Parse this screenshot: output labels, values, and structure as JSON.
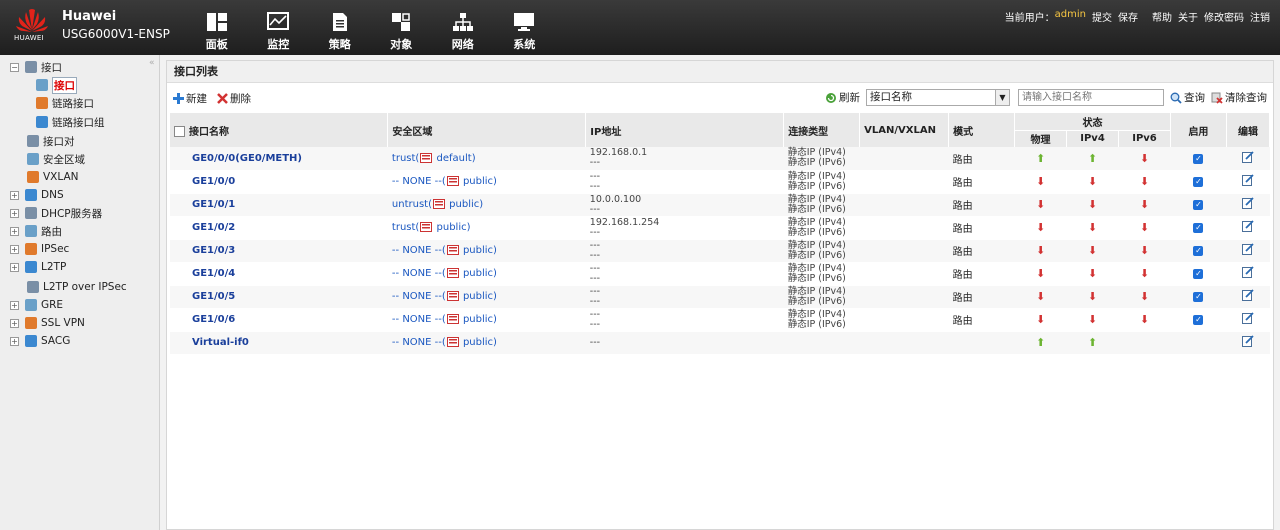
{
  "header": {
    "logo_text": "HUAWEI",
    "brand": "Huawei",
    "model": "USG6000V1-ENSP",
    "nav": [
      {
        "label": "面板",
        "icon": "dashboard-icon"
      },
      {
        "label": "监控",
        "icon": "monitor-icon"
      },
      {
        "label": "策略",
        "icon": "policy-icon"
      },
      {
        "label": "对象",
        "icon": "object-icon"
      },
      {
        "label": "网络",
        "icon": "network-icon"
      },
      {
        "label": "系统",
        "icon": "system-icon"
      }
    ],
    "current_user_label": "当前用户：",
    "current_user": "admin",
    "links": [
      "提交",
      "保存",
      "帮助",
      "关于",
      "修改密码",
      "注销"
    ]
  },
  "sidebar": {
    "items": [
      {
        "label": "接口",
        "toggle": "−",
        "icon": "interface-icon"
      },
      {
        "label": "接口",
        "selected": true,
        "icon": "interface-icon"
      },
      {
        "label": "链路接口",
        "icon": "link-interface-icon"
      },
      {
        "label": "链路接口组",
        "icon": "link-group-icon"
      },
      {
        "label": "接口对",
        "icon": "interface-pair-icon"
      },
      {
        "label": "安全区域",
        "icon": "security-zone-icon"
      },
      {
        "label": "VXLAN",
        "icon": "vxlan-icon"
      },
      {
        "label": "DNS",
        "toggle": "+",
        "icon": "dns-icon"
      },
      {
        "label": "DHCP服务器",
        "toggle": "+",
        "icon": "dhcp-icon"
      },
      {
        "label": "路由",
        "toggle": "+",
        "icon": "route-icon"
      },
      {
        "label": "IPSec",
        "toggle": "+",
        "icon": "ipsec-icon"
      },
      {
        "label": "L2TP",
        "toggle": "+",
        "icon": "l2tp-icon"
      },
      {
        "label": "L2TP over IPSec",
        "icon": "l2tp-ipsec-icon"
      },
      {
        "label": "GRE",
        "toggle": "+",
        "icon": "gre-icon"
      },
      {
        "label": "SSL VPN",
        "toggle": "+",
        "icon": "sslvpn-icon"
      },
      {
        "label": "SACG",
        "toggle": "+",
        "icon": "sacg-icon"
      }
    ]
  },
  "main": {
    "title": "接口列表",
    "toolbar": {
      "new_label": "新建",
      "delete_label": "删除",
      "refresh_label": "刷新",
      "select_value": "接口名称",
      "search_placeholder": "请输入接口名称",
      "query_label": "查询",
      "clear_label": "清除查询"
    },
    "columns": {
      "name": "接口名称",
      "zone": "安全区域",
      "ip": "IP地址",
      "conn": "连接类型",
      "vlan": "VLAN/VXLAN",
      "mode": "模式",
      "status": "状态",
      "physical": "物理",
      "ipv4": "IPv4",
      "ipv6": "IPv6",
      "enable": "启用",
      "edit": "编辑"
    },
    "rows": [
      {
        "name": "GE0/0/0(GE0/METH)",
        "zone_a": "trust(",
        "zone_b": " default)",
        "ip1": "192.168.0.1",
        "ip2": "---",
        "conn1": "静态IP (IPv4)",
        "conn2": "静态IP (IPv6)",
        "mode": "路由",
        "phy": "up",
        "v4": "up",
        "v6": "down",
        "enabled": true
      },
      {
        "name": "GE1/0/0",
        "zone_a": "-- NONE --(",
        "zone_b": " public)",
        "ip1": "---",
        "ip2": "---",
        "conn1": "静态IP (IPv4)",
        "conn2": "静态IP (IPv6)",
        "mode": "路由",
        "phy": "down",
        "v4": "down",
        "v6": "down",
        "enabled": true
      },
      {
        "name": "GE1/0/1",
        "zone_a": "untrust(",
        "zone_b": " public)",
        "ip1": "10.0.0.100",
        "ip2": "---",
        "conn1": "静态IP (IPv4)",
        "conn2": "静态IP (IPv6)",
        "mode": "路由",
        "phy": "down",
        "v4": "down",
        "v6": "down",
        "enabled": true
      },
      {
        "name": "GE1/0/2",
        "zone_a": "trust(",
        "zone_b": " public)",
        "ip1": "192.168.1.254",
        "ip2": "---",
        "conn1": "静态IP (IPv4)",
        "conn2": "静态IP (IPv6)",
        "mode": "路由",
        "phy": "down",
        "v4": "down",
        "v6": "down",
        "enabled": true
      },
      {
        "name": "GE1/0/3",
        "zone_a": "-- NONE --(",
        "zone_b": " public)",
        "ip1": "---",
        "ip2": "---",
        "conn1": "静态IP (IPv4)",
        "conn2": "静态IP (IPv6)",
        "mode": "路由",
        "phy": "down",
        "v4": "down",
        "v6": "down",
        "enabled": true
      },
      {
        "name": "GE1/0/4",
        "zone_a": "-- NONE --(",
        "zone_b": " public)",
        "ip1": "---",
        "ip2": "---",
        "conn1": "静态IP (IPv4)",
        "conn2": "静态IP (IPv6)",
        "mode": "路由",
        "phy": "down",
        "v4": "down",
        "v6": "down",
        "enabled": true
      },
      {
        "name": "GE1/0/5",
        "zone_a": "-- NONE --(",
        "zone_b": " public)",
        "ip1": "---",
        "ip2": "---",
        "conn1": "静态IP (IPv4)",
        "conn2": "静态IP (IPv6)",
        "mode": "路由",
        "phy": "down",
        "v4": "down",
        "v6": "down",
        "enabled": true
      },
      {
        "name": "GE1/0/6",
        "zone_a": "-- NONE --(",
        "zone_b": " public)",
        "ip1": "---",
        "ip2": "---",
        "conn1": "静态IP (IPv4)",
        "conn2": "静态IP (IPv6)",
        "mode": "路由",
        "phy": "down",
        "v4": "down",
        "v6": "down",
        "enabled": true
      },
      {
        "name": "Virtual-if0",
        "zone_a": "-- NONE --(",
        "zone_b": " public)",
        "ip1": "---",
        "ip2": "",
        "conn1": "",
        "conn2": "",
        "mode": "",
        "phy": "up",
        "v4": "up",
        "v6": "",
        "enabled": false
      }
    ]
  },
  "colors": {
    "accent_red": "#d23232",
    "up_green": "#6cb431",
    "link_blue": "#1a57c0"
  }
}
